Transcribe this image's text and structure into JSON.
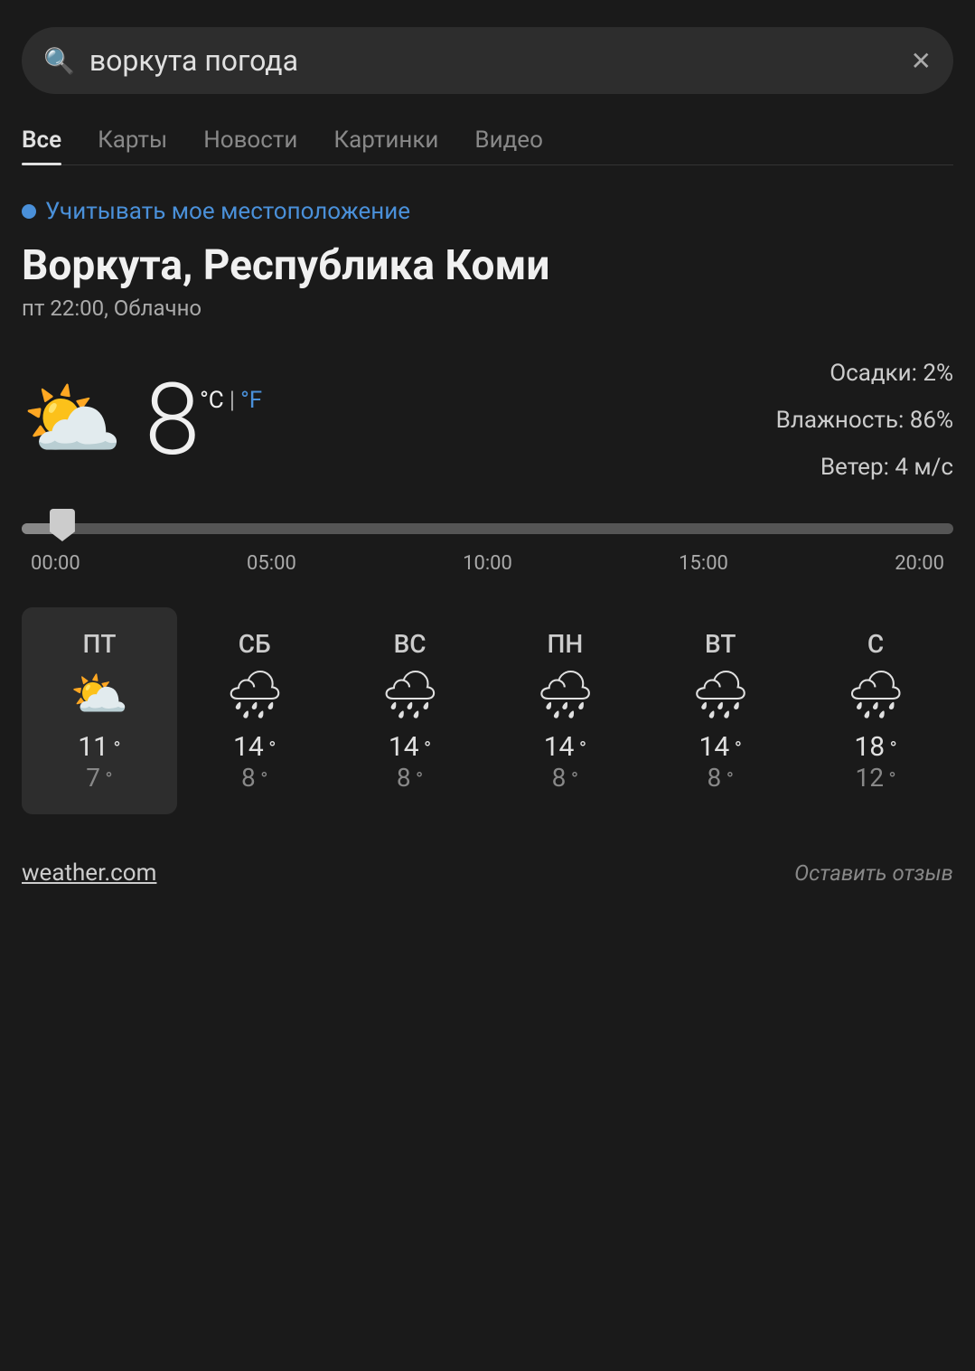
{
  "search": {
    "query": "воркута погода",
    "placeholder": "воркута погода",
    "clear_label": "×"
  },
  "tabs": [
    {
      "label": "Все",
      "active": true
    },
    {
      "label": "Карты",
      "active": false
    },
    {
      "label": "Новости",
      "active": false
    },
    {
      "label": "Картинки",
      "active": false
    },
    {
      "label": "Видео",
      "active": false
    }
  ],
  "location_toggle": "Учитывать мое местоположение",
  "city": {
    "name": "Воркута, Республика Коми",
    "time": "пт 22:00, Облачно"
  },
  "current_weather": {
    "temperature": "8",
    "unit_c": "°C",
    "separator": "|",
    "unit_f": "°F",
    "precipitation": "Осадки: 2%",
    "humidity": "Влажность: 86%",
    "wind": "Ветер: 4 м/с"
  },
  "timeline": {
    "labels": [
      "00:00",
      "05:00",
      "10:00",
      "15:00",
      "20:00"
    ]
  },
  "forecast": [
    {
      "day": "ПТ",
      "icon": "cloudy",
      "high": "11",
      "low": "7",
      "active": true
    },
    {
      "day": "СБ",
      "icon": "rainy",
      "high": "14",
      "low": "8",
      "active": false
    },
    {
      "day": "ВС",
      "icon": "rainy",
      "high": "14",
      "low": "8",
      "active": false
    },
    {
      "day": "ПН",
      "icon": "rainy",
      "high": "14",
      "low": "8",
      "active": false
    },
    {
      "day": "ВТ",
      "icon": "rainy",
      "high": "14",
      "low": "8",
      "active": false
    },
    {
      "day": "С",
      "icon": "rainy",
      "high": "18",
      "low": "12",
      "active": false
    }
  ],
  "footer": {
    "source": "weather.com",
    "feedback": "Оставить отзыв"
  }
}
